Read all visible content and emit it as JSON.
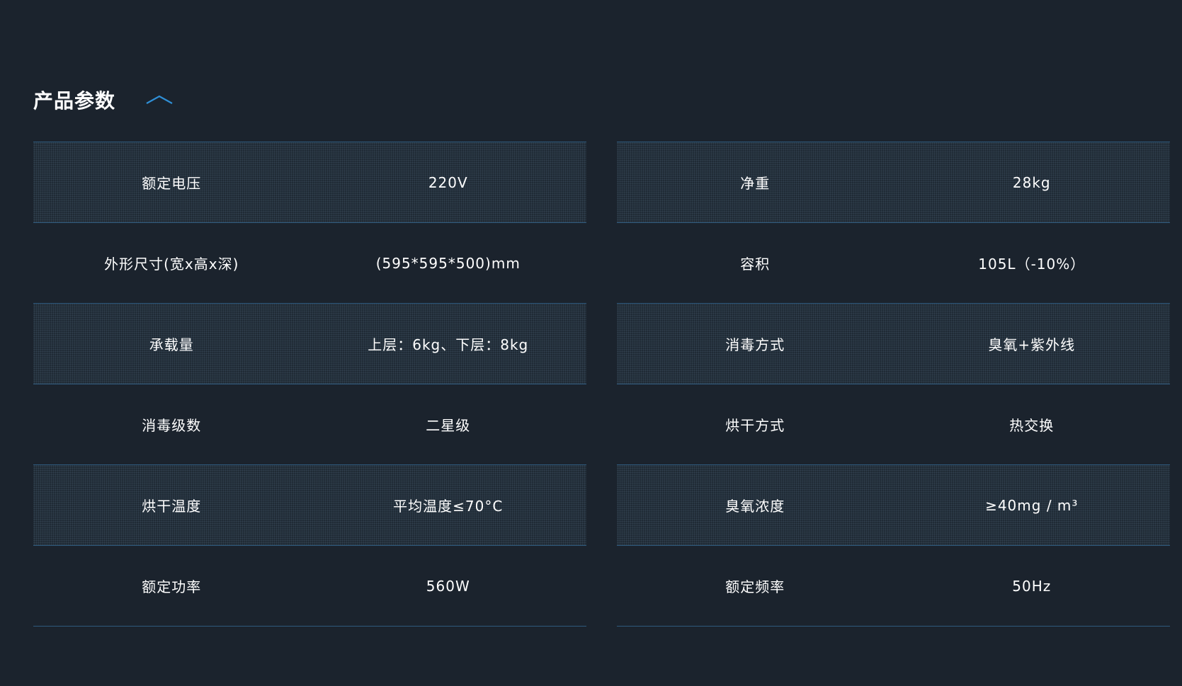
{
  "section": {
    "title": "产品参数"
  },
  "icons": {
    "collapse": "chevron-up-icon"
  },
  "colors": {
    "background": "#1b232d",
    "accent": "#2f8fd6",
    "divider": "#2f5a7e"
  },
  "left_table": [
    {
      "label": "额定电压",
      "value": "220V"
    },
    {
      "label": "外形尺寸(宽x高x深)",
      "value": "(595*595*500)mm"
    },
    {
      "label": "承载量",
      "value": "上层：6kg、下层：8kg"
    },
    {
      "label": "消毒级数",
      "value": "二星级"
    },
    {
      "label": "烘干温度",
      "value": "平均温度≤70°C"
    },
    {
      "label": "额定功率",
      "value": "560W"
    }
  ],
  "right_table": [
    {
      "label": "净重",
      "value": "28kg"
    },
    {
      "label": "容积",
      "value": "105L（-10%）"
    },
    {
      "label": "消毒方式",
      "value": "臭氧+紫外线"
    },
    {
      "label": "烘干方式",
      "value": "热交换"
    },
    {
      "label": "臭氧浓度",
      "value": "≥40mg / m³"
    },
    {
      "label": "额定频率",
      "value": "50Hz"
    }
  ]
}
